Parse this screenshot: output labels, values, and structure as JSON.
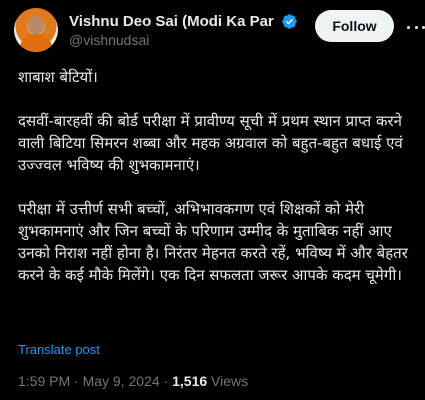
{
  "author": {
    "display_name": "Vishnu Deo Sai (Modi Ka Par",
    "handle": "@vishnudsai",
    "verified": true
  },
  "follow_label": "Follow",
  "tweet": {
    "paragraphs": [
      "शाबाश बेटियों।",
      "दसवीं-बारहवीं की बोर्ड परीक्षा में प्रावीण्य सूची में प्रथम स्थान प्राप्त करने वाली बिटिया सिमरन शब्बा और महक अग्रवाल को बहुत-बहुत बधाई एवं उज्ज्वल भविष्य की शुभकामनाएं।",
      "परीक्षा में उत्तीर्ण सभी बच्चों, अभिभावकगण एवं शिक्षकों को मेरी शुभकामनाएं और जिन बच्चों के परिणाम उम्मीद के मुताबिक नहीं आए उनको निराश नहीं होना है। निरंतर मेहनत करते रहें, भविष्य में और बेहतर करने के कई मौके मिलेंगे। एक दिन सफलता जरूर आपके कदम चूमेगी।"
    ]
  },
  "translate_label": "Translate post",
  "meta": {
    "time": "1:59 PM",
    "separator": " · ",
    "date": "May 9, 2024",
    "views_count": "1,516",
    "views_label": " Views"
  },
  "colors": {
    "background": "#000000",
    "text": "#e7e9ea",
    "muted": "#71767b",
    "link": "#1d9bf0",
    "verified": "#1d9bf0"
  },
  "icons": {
    "verified": "verified-badge-icon",
    "more": "more-options-icon"
  }
}
